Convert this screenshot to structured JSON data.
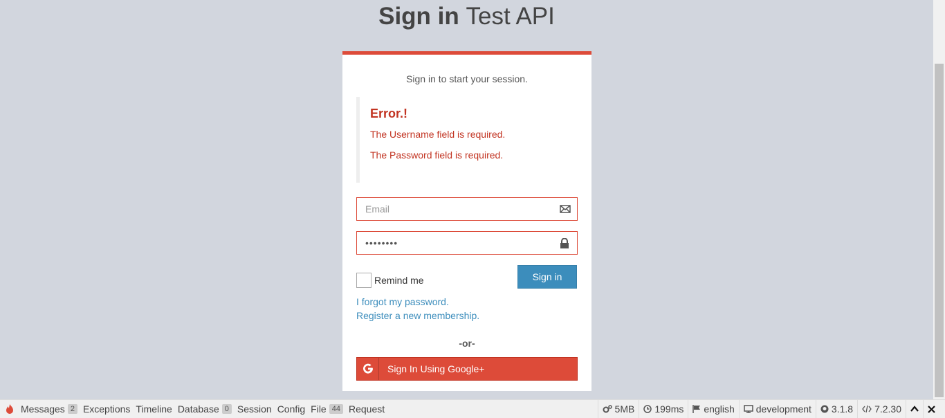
{
  "header": {
    "title_bold": "Sign in",
    "title_rest": "Test API"
  },
  "login": {
    "message": "Sign in to start your session.",
    "error": {
      "title": "Error.!",
      "messages": [
        "The Username field is required.",
        "The Password field is required."
      ]
    },
    "email": {
      "placeholder": "Email",
      "value": ""
    },
    "password": {
      "value": "••••••••"
    },
    "remember_label": "Remind me",
    "signin_label": "Sign in",
    "forgot_link": "I forgot my password.",
    "register_link": "Register a new membership.",
    "or_text": "-or-",
    "google_label": "Sign In Using Google+"
  },
  "toolbar": {
    "items": [
      {
        "label": "Messages",
        "badge": "2"
      },
      {
        "label": "Exceptions"
      },
      {
        "label": "Timeline"
      },
      {
        "label": "Database",
        "badge": "0"
      },
      {
        "label": "Session"
      },
      {
        "label": "Config"
      },
      {
        "label": "File",
        "badge": "44"
      },
      {
        "label": "Request"
      }
    ],
    "memory": "5MB",
    "time": "199ms",
    "locale": "english",
    "environment": "development",
    "version": "3.1.8",
    "php_version": "7.2.30"
  },
  "colors": {
    "danger": "#dd4b39",
    "primary": "#3c8dbc",
    "background": "#d2d6de"
  }
}
